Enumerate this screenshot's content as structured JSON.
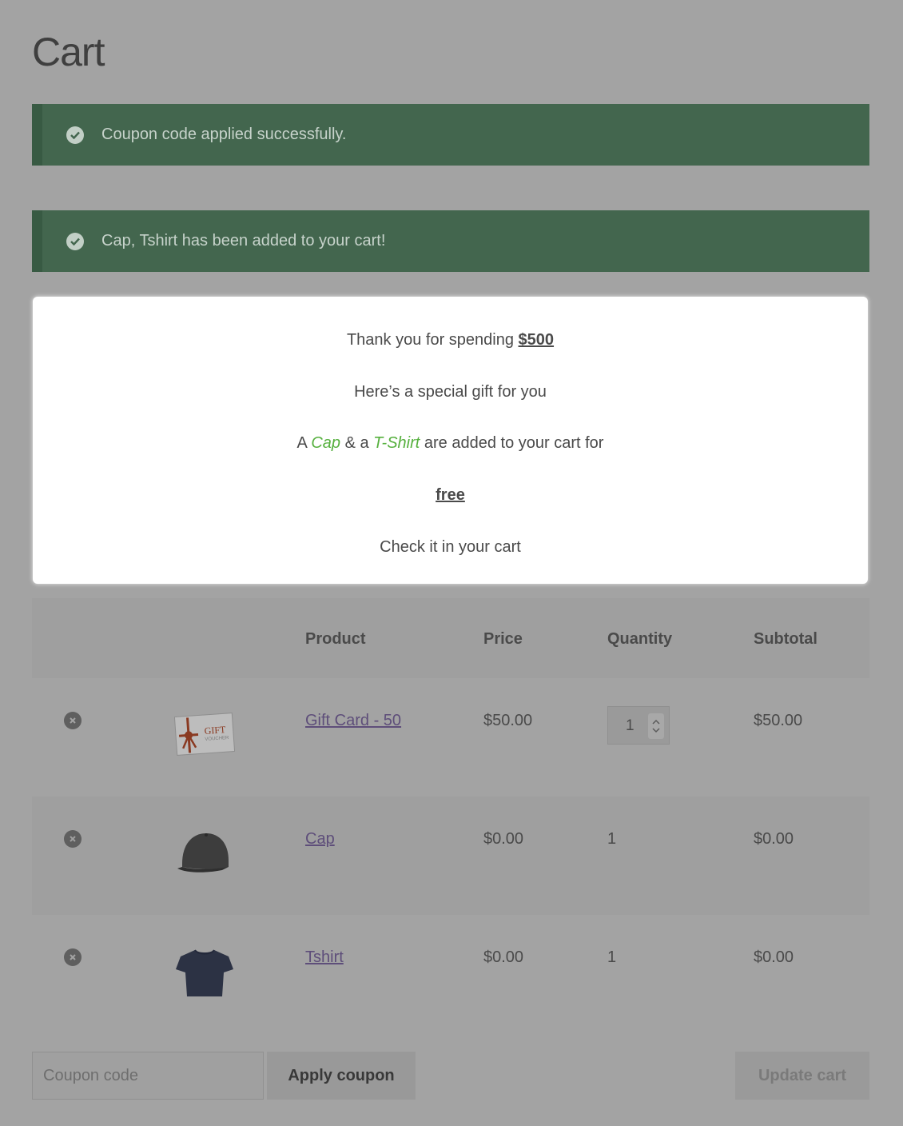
{
  "page": {
    "title": "Cart"
  },
  "notices": [
    {
      "text": "Coupon code applied successfully."
    },
    {
      "text": "Cap, Tshirt has been added to your cart!"
    }
  ],
  "popup": {
    "line1_prefix": "Thank you for spending ",
    "line1_amount": "$500",
    "line2": "Here’s a special gift for you",
    "line3_a": "A ",
    "line3_cap": "Cap",
    "line3_and": " & a ",
    "line3_tshirt": "T-Shirt",
    "line3_suffix": " are added to your cart for",
    "line4": "free",
    "line5": "Check it in your cart"
  },
  "table": {
    "headers": {
      "product": "Product",
      "price": "Price",
      "quantity": "Quantity",
      "subtotal": "Subtotal"
    },
    "rows": [
      {
        "product": "Gift Card - 50",
        "price": "$50.00",
        "quantity": "1",
        "subtotal": "$50.00",
        "image": "gift-voucher-image"
      },
      {
        "product": "Cap",
        "price": "$0.00",
        "quantity": "1",
        "subtotal": "$0.00",
        "image": "cap-image"
      },
      {
        "product": "Tshirt",
        "price": "$0.00",
        "quantity": "1",
        "subtotal": "$0.00",
        "image": "tshirt-image"
      }
    ]
  },
  "actions": {
    "coupon_placeholder": "Coupon code",
    "apply_coupon": "Apply coupon",
    "update_cart": "Update cart"
  },
  "colors": {
    "overlay_bg": "#a3a3a3",
    "notice_bg": "#43664e",
    "highlight_green": "#56b03e",
    "popup_bg": "#ffffff",
    "link": "#5e4e7a"
  }
}
